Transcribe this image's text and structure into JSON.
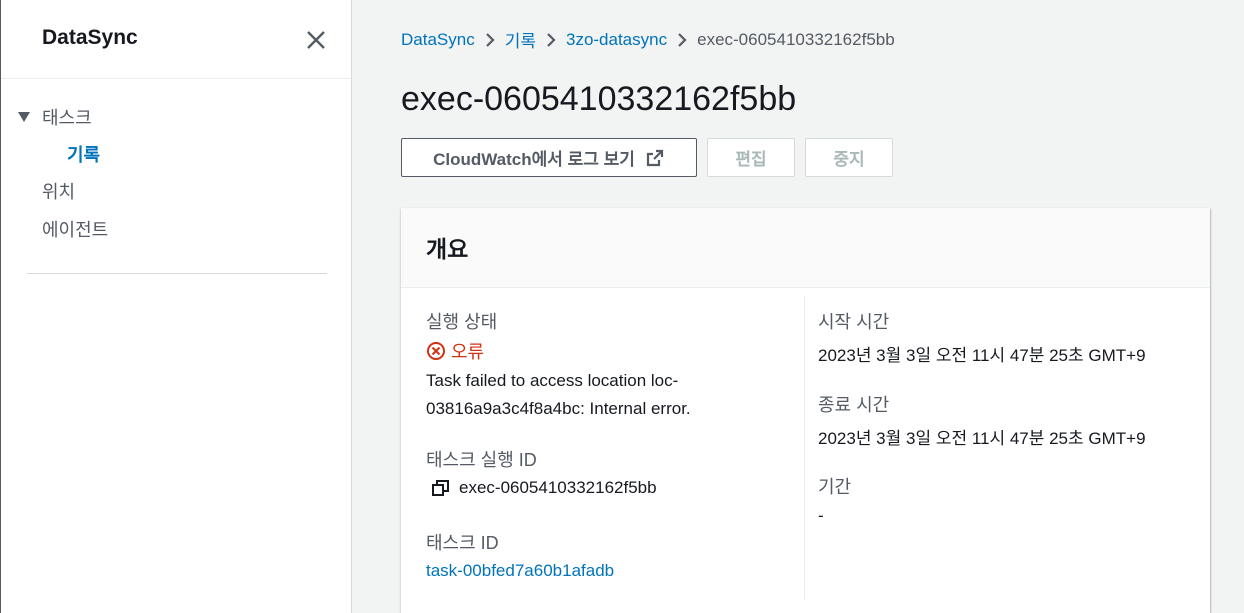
{
  "sidebar": {
    "title": "DataSync",
    "items": [
      {
        "label": "태스크"
      },
      {
        "label": "기록"
      },
      {
        "label": "위치"
      },
      {
        "label": "에이전트"
      }
    ]
  },
  "breadcrumb": {
    "items": [
      "DataSync",
      "기록",
      "3zo-datasync"
    ],
    "current": "exec-0605410332162f5bb"
  },
  "page": {
    "title": "exec-0605410332162f5bb"
  },
  "actions": {
    "cloudwatch_label": "CloudWatch에서 로그 보기",
    "edit_label": "편집",
    "stop_label": "중지"
  },
  "overview": {
    "title": "개요",
    "status_label": "실행 상태",
    "status_value": "오류",
    "error_message": "Task failed to access location loc-03816a9a3c4f8a4bc: Internal error.",
    "execution_id_label": "태스크 실행 ID",
    "execution_id_value": "exec-0605410332162f5bb",
    "task_id_label": "태스크 ID",
    "task_id_value": "task-00bfed7a60b1afadb",
    "start_time_label": "시작 시간",
    "start_time_value": "2023년 3월 3일 오전 11시 47분 25초 GMT+9",
    "end_time_label": "종료 시간",
    "end_time_value": "2023년 3월 3일 오전 11시 47분 25초 GMT+9",
    "duration_label": "기간",
    "duration_value": "-"
  },
  "colors": {
    "link": "#0073bb",
    "error": "#d13212",
    "text": "#16191f",
    "muted": "#545b64"
  }
}
